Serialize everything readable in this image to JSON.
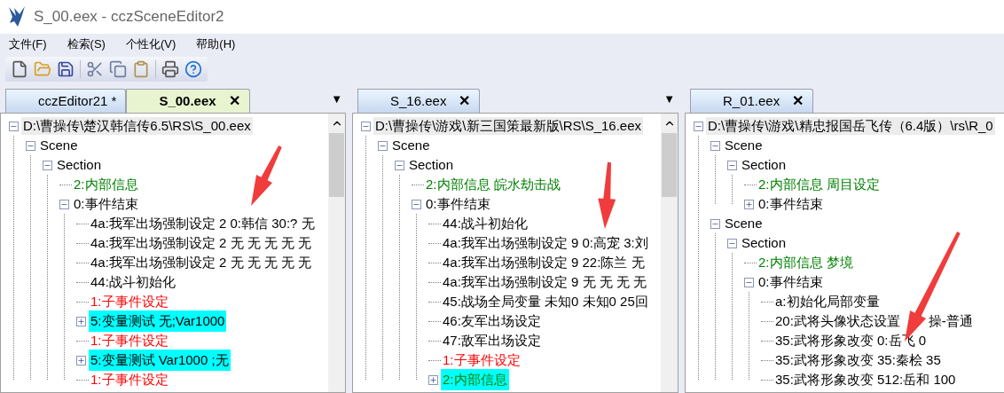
{
  "window": {
    "title": "S_00.eex - cczSceneEditor2"
  },
  "menu": [
    "文件(F)",
    "检索(S)",
    "个性化(V)",
    "帮助(H)"
  ],
  "panes": [
    {
      "tabs": [
        {
          "label": "cczEditor21 *",
          "selected": false
        },
        {
          "label": "S_00.eex",
          "selected": true,
          "close": "✕"
        }
      ],
      "dropdown": "▼",
      "scrollbar": true,
      "tree": [
        {
          "text": "D:\\曹操传\\楚汉韩信传6.5\\RS\\S_00.eex",
          "expanded": true,
          "children": [
            {
              "text": "Scene",
              "expanded": true,
              "children": [
                {
                  "text": "Section",
                  "expanded": true,
                  "children": [
                    {
                      "text": "2:内部信息",
                      "color": "#008000"
                    },
                    {
                      "text": "0:事件结束",
                      "expanded": true,
                      "children": [
                        {
                          "text": "4a:我军出场强制设定 2 0:韩信 30:?  无"
                        },
                        {
                          "text": "4a:我军出场强制设定 2 无 无 无 无 无"
                        },
                        {
                          "text": "4a:我军出场强制设定 2 无 无 无 无 无"
                        },
                        {
                          "text": "44:战斗初始化"
                        },
                        {
                          "text": "1:子事件设定",
                          "color": "#ff0000"
                        },
                        {
                          "text": "5:变量测试 无;Var1000",
                          "expanded": false,
                          "highlighted": true
                        },
                        {
                          "text": "1:子事件设定",
                          "color": "#ff0000"
                        },
                        {
                          "text": "5:变量测试 Var1000 ;无",
                          "expanded": false,
                          "highlighted": true
                        },
                        {
                          "text": "1:子事件设定",
                          "color": "#ff0000"
                        }
                      ]
                    }
                  ]
                }
              ]
            }
          ]
        }
      ]
    },
    {
      "tabs": [
        {
          "label": "S_16.eex",
          "selected": false,
          "close": "✕"
        }
      ],
      "dropdown": "▼",
      "scrollbar": true,
      "tree": [
        {
          "text": "D:\\曹操传\\游戏\\新三国策最新版\\RS\\S_16.eex",
          "expanded": true,
          "children": [
            {
              "text": "Scene",
              "expanded": true,
              "children": [
                {
                  "text": "Section",
                  "expanded": true,
                  "children": [
                    {
                      "text": "2:内部信息 皖水劫击战",
                      "color": "#008000"
                    },
                    {
                      "text": "0:事件结束",
                      "expanded": true,
                      "children": [
                        {
                          "text": "44:战斗初始化"
                        },
                        {
                          "text": "4a:我军出场强制设定 9 0:高宠 3:刘"
                        },
                        {
                          "text": "4a:我军出场强制设定 9 22:陈兰 无"
                        },
                        {
                          "text": "4a:我军出场强制设定 9 无 无 无 无"
                        },
                        {
                          "text": "45:战场全局变量 未知0 未知0 25回"
                        },
                        {
                          "text": "46:友军出场设定"
                        },
                        {
                          "text": "47:敌军出场设定"
                        },
                        {
                          "text": "1:子事件设定",
                          "color": "#ff0000"
                        },
                        {
                          "text": "2:内部信息",
                          "color": "#008000",
                          "expanded": false,
                          "highlighted": true
                        }
                      ]
                    }
                  ]
                }
              ]
            }
          ]
        }
      ]
    },
    {
      "tabs": [
        {
          "label": "R_01.eex",
          "selected": false,
          "close": "✕"
        }
      ],
      "tree": [
        {
          "text": "D:\\曹操传\\游戏\\精忠报国岳飞传（6.4版）\\rs\\R_0",
          "expanded": true,
          "children": [
            {
              "text": "Scene",
              "expanded": true,
              "children": [
                {
                  "text": "Section",
                  "expanded": true,
                  "children": [
                    {
                      "text": "2:内部信息 周目设定",
                      "color": "#008000"
                    },
                    {
                      "text": "0:事件结束",
                      "expanded": false
                    }
                  ]
                }
              ]
            },
            {
              "text": "Scene",
              "expanded": true,
              "children": [
                {
                  "text": "Section",
                  "expanded": true,
                  "children": [
                    {
                      "text": "2:内部信息 梦境",
                      "color": "#008000"
                    },
                    {
                      "text": "0:事件结束",
                      "expanded": true,
                      "children": [
                        {
                          "text": "a:初始化局部变量"
                        },
                        {
                          "text": "20:武将头像状态设置",
                          "text_after_arrow": "操-普通"
                        },
                        {
                          "text": "35:武将形象改变 0:岳飞 0"
                        },
                        {
                          "text": "35:武将形象改变 35:秦桧 35"
                        },
                        {
                          "text": "35:武将形象改变 512:岳和 100"
                        }
                      ]
                    }
                  ]
                }
              ]
            }
          ]
        }
      ]
    }
  ]
}
